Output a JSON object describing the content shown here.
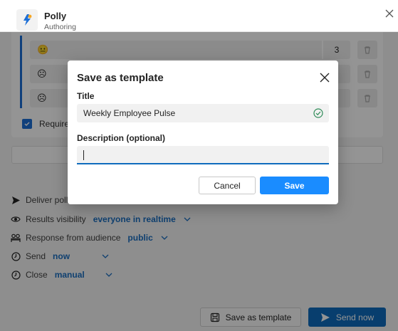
{
  "header": {
    "app_name": "Polly",
    "app_subtitle": "Authoring"
  },
  "poll": {
    "options": [
      {
        "emoji": "☹",
        "count": "3"
      },
      {
        "emoji": "☹",
        "count": ""
      },
      {
        "emoji": "☹",
        "count": ""
      }
    ],
    "required_label": "Required"
  },
  "settings": {
    "deliver_label": "Deliver poll",
    "visibility_label": "Results visibility",
    "visibility_value": "everyone in realtime",
    "response_label": "Response from audience",
    "response_value": "public",
    "send_label": "Send",
    "send_value": "now",
    "close_label": "Close",
    "close_value": "manual"
  },
  "footer": {
    "save_template_label": "Save as template",
    "send_now_label": "Send now"
  },
  "dialog": {
    "title": "Save as template",
    "title_field_label": "Title",
    "title_field_value": "Weekly Employee Pulse",
    "description_label": "Description (optional)",
    "description_value": "",
    "cancel_label": "Cancel",
    "save_label": "Save"
  },
  "colors": {
    "accent": "#0f6cbd",
    "save_button": "#1a8cff",
    "valid_check": "#2e8b57"
  }
}
